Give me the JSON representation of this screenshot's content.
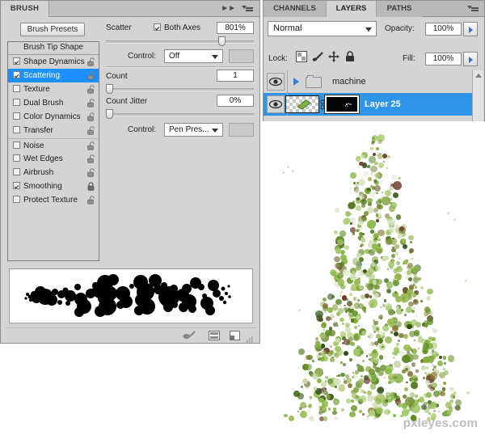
{
  "brush_panel": {
    "tab_label": "BRUSH",
    "collapse_icon": "double-chevron-right-icon",
    "menu_icon": "panel-menu-icon",
    "presets_button": "Brush Presets",
    "tip_list_header": "Brush Tip Shape",
    "tip_items": [
      {
        "label": "Shape Dynamics",
        "checked": true,
        "selected": false,
        "locked": false,
        "group_start": false
      },
      {
        "label": "Scattering",
        "checked": true,
        "selected": true,
        "locked": false,
        "group_start": false
      },
      {
        "label": "Texture",
        "checked": false,
        "selected": false,
        "locked": false,
        "group_start": false
      },
      {
        "label": "Dual Brush",
        "checked": false,
        "selected": false,
        "locked": false,
        "group_start": false
      },
      {
        "label": "Color Dynamics",
        "checked": false,
        "selected": false,
        "locked": false,
        "group_start": false
      },
      {
        "label": "Transfer",
        "checked": false,
        "selected": false,
        "locked": false,
        "group_start": false
      },
      {
        "label": "Noise",
        "checked": false,
        "selected": false,
        "locked": false,
        "group_start": true
      },
      {
        "label": "Wet Edges",
        "checked": false,
        "selected": false,
        "locked": false,
        "group_start": false
      },
      {
        "label": "Airbrush",
        "checked": false,
        "selected": false,
        "locked": false,
        "group_start": false
      },
      {
        "label": "Smoothing",
        "checked": true,
        "selected": false,
        "locked": true,
        "group_start": false
      },
      {
        "label": "Protect Texture",
        "checked": false,
        "selected": false,
        "locked": false,
        "group_start": false
      }
    ],
    "controls": {
      "scatter_label": "Scatter",
      "both_axes_label": "Both Axes",
      "both_axes_checked": true,
      "scatter_value": "801%",
      "scatter_slider_percent": 80,
      "control1_label": "Control:",
      "control1_value": "Off",
      "count_label": "Count",
      "count_value": "1",
      "count_slider_percent": 0,
      "count_jitter_label": "Count Jitter",
      "count_jitter_value": "0%",
      "count_jitter_slider_percent": 0,
      "control2_label": "Control:",
      "control2_value": "Pen Pres..."
    },
    "footer_icons": [
      "brush-tool-icon",
      "new-brush-preset-icon",
      "new-layer-icon",
      "resize-grip-icon"
    ],
    "preview_alt": "brush-stroke-preview"
  },
  "layers_panel": {
    "tabs": [
      {
        "label": "CHANNELS",
        "active": false
      },
      {
        "label": "LAYERS",
        "active": true
      },
      {
        "label": "PATHS",
        "active": false
      }
    ],
    "menu_icon": "panel-menu-icon",
    "blend_mode": "Normal",
    "opacity_label": "Opacity:",
    "opacity_value": "100%",
    "fill_label": "Fill:",
    "fill_value": "100%",
    "lock_label": "Lock:",
    "lock_buttons": [
      {
        "name": "lock-transparent-pixels-icon"
      },
      {
        "name": "lock-image-pixels-icon"
      },
      {
        "name": "lock-position-icon"
      },
      {
        "name": "lock-all-icon"
      }
    ],
    "layers": [
      {
        "name": "machine",
        "type": "group",
        "selected": false,
        "visible": true,
        "expanded": false
      },
      {
        "name": "Layer 25",
        "type": "layer",
        "selected": true,
        "visible": true,
        "has_mask": true,
        "linked": true
      }
    ],
    "scroll_arrow_icon": "scroll-up-arrow-icon"
  },
  "canvas": {
    "artwork_name": "scattered-green-foliage-artwork",
    "watermark": "pxleyes.com"
  },
  "colors": {
    "selection_blue": "#1e90ff",
    "layer_select_blue": "#2f95e8",
    "panel_gray": "#d4d4d4",
    "tab_gray": "#b9b9b9",
    "foliage_green": "#6f9e2e",
    "watermark_gray": "#bdbdbd"
  }
}
